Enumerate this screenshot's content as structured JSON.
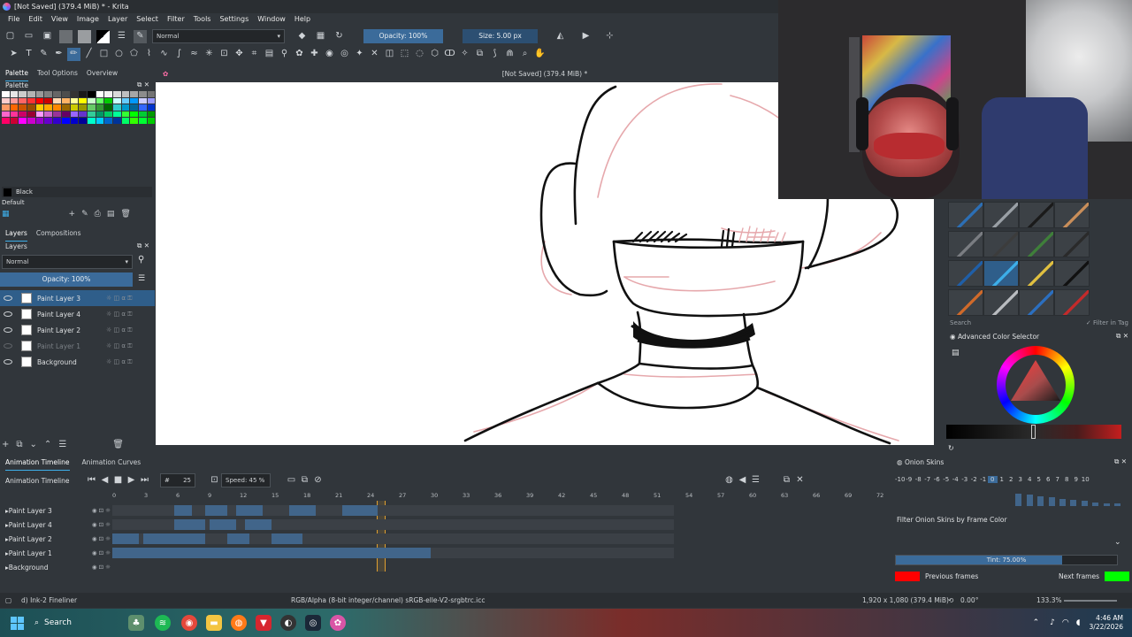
{
  "window": {
    "title": "[Not Saved]  (379.4 MiB) * - Krita"
  },
  "menu": [
    "File",
    "Edit",
    "View",
    "Image",
    "Layer",
    "Select",
    "Filter",
    "Tools",
    "Settings",
    "Window",
    "Help"
  ],
  "toolbar": {
    "blend_mode": "Normal",
    "opacity": "Opacity: 100%",
    "size": "Size: 5.00 px"
  },
  "left_tabs": [
    "Palette",
    "Tool Options",
    "Overview"
  ],
  "palette": {
    "title": "Palette",
    "current_color_name": "Black",
    "palette_name": "Default",
    "swatch_colors": [
      "#ffffff",
      "#e6e6e6",
      "#cccccc",
      "#b3b3b3",
      "#999999",
      "#808080",
      "#666666",
      "#4d4d4d",
      "#333333",
      "#1a1a1a",
      "#000000",
      "#ffffff",
      "#f2f2f2",
      "#d9d9d9",
      "#bfbfbf",
      "#a6a6a6",
      "#8c8c8c",
      "#737373",
      "#ffcccc",
      "#ff9999",
      "#ff6666",
      "#ff3333",
      "#ff0000",
      "#cc0000",
      "#ffd9b3",
      "#ffb366",
      "#ffff99",
      "#ffff00",
      "#ccffcc",
      "#66ff66",
      "#00cc00",
      "#ccffff",
      "#66ccff",
      "#0099ff",
      "#ccccff",
      "#9999ff",
      "#ff9966",
      "#ff6600",
      "#cc5200",
      "#994d00",
      "#ffcc00",
      "#ffaa00",
      "#ff8800",
      "#996600",
      "#cccc00",
      "#999900",
      "#66cc66",
      "#339933",
      "#006600",
      "#33cccc",
      "#0099cc",
      "#006699",
      "#3366ff",
      "#0033cc",
      "#ff66cc",
      "#ff3399",
      "#cc0066",
      "#990033",
      "#ff99ff",
      "#cc66cc",
      "#993399",
      "#660066",
      "#9966ff",
      "#6633cc",
      "#33cc99",
      "#009966",
      "#00cc66",
      "#00ff99",
      "#33ff33",
      "#00ff00",
      "#00cc33",
      "#009900",
      "#ff0066",
      "#cc0033",
      "#ff00ff",
      "#cc00cc",
      "#9900cc",
      "#6600cc",
      "#3300cc",
      "#0000ff",
      "#0000cc",
      "#000099",
      "#00ffcc",
      "#00ccff",
      "#0066cc",
      "#003399",
      "#00ff66",
      "#33ff00",
      "#00ff33",
      "#00cc00"
    ]
  },
  "layers": {
    "tabs": [
      "Layers",
      "Compositions"
    ],
    "blend_mode": "Normal",
    "opacity": "Opacity: 100%",
    "items": [
      {
        "name": "Paint Layer 3",
        "selected": true,
        "visible": true
      },
      {
        "name": "Paint Layer 4",
        "selected": false,
        "visible": true
      },
      {
        "name": "Paint Layer 2",
        "selected": false,
        "visible": true
      },
      {
        "name": "Paint Layer 1",
        "selected": false,
        "visible": false
      },
      {
        "name": "Background",
        "selected": false,
        "visible": true
      }
    ]
  },
  "canvas": {
    "tab_title": "[Not Saved]  (379.4 MiB) *"
  },
  "brushes": {
    "search_placeholder": "Search",
    "filter_in_tag": "Filter in Tag"
  },
  "color_selector": {
    "title": "Advanced Color Selector"
  },
  "timeline": {
    "tabs": [
      "Animation Timeline",
      "Animation Curves"
    ],
    "title": "Animation Timeline",
    "current_frame": "25",
    "speed": "Speed: 45 %",
    "ruler": [
      "0",
      "3",
      "6",
      "9",
      "12",
      "15",
      "18",
      "21",
      "24",
      "27",
      "30",
      "33",
      "36",
      "39",
      "42",
      "45",
      "48",
      "51",
      "54",
      "57",
      "60",
      "63",
      "66",
      "69",
      "72"
    ],
    "layers": [
      "Paint Layer 3",
      "Paint Layer 4",
      "Paint Layer 2",
      "Paint Layer 1",
      "Background"
    ]
  },
  "onion": {
    "title": "Onion Skins",
    "numbers": [
      "-10",
      "-9",
      "-8",
      "-7",
      "-6",
      "-5",
      "-4",
      "-3",
      "-2",
      "-1",
      "0",
      "1",
      "2",
      "3",
      "4",
      "5",
      "6",
      "7",
      "8",
      "9",
      "10"
    ],
    "filter_label": "Filter Onion Skins by Frame Color",
    "tint": "Tint: 75.00%",
    "previous_label": "Previous frames",
    "next_label": "Next frames",
    "previous_color": "#ff0000",
    "next_color": "#00ff00"
  },
  "status": {
    "brush": "d) Ink-2 Fineliner",
    "colorspace": "RGB/Alpha (8-bit integer/channel)  sRGB-elle-V2-srgbtrc.icc",
    "dimensions": "1,920 x 1,080 (379.4 MiB)",
    "rotation": "0.00°",
    "zoom": "133.3%"
  },
  "taskbar": {
    "search": "Search",
    "time": "4:46 AM",
    "date": "3/22/2026"
  }
}
